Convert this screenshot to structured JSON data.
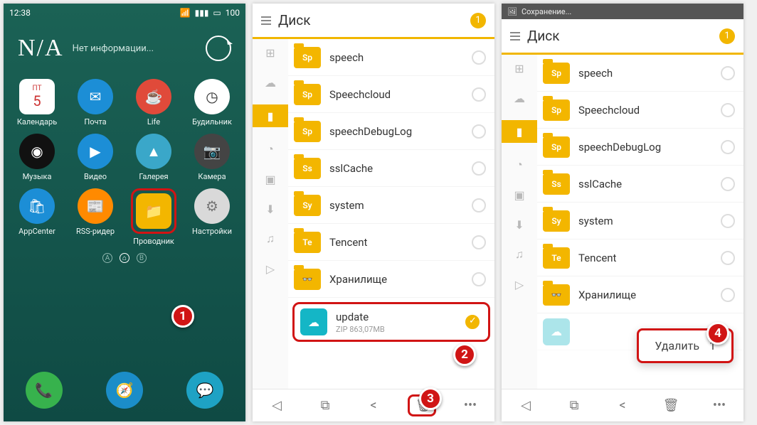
{
  "statusbar": {
    "time": "12:38",
    "battery": "100"
  },
  "weather": {
    "na": "N/A",
    "info": "Нет информации..."
  },
  "apps_row1": [
    {
      "label": "Календарь",
      "short": "5",
      "sup": "ПТ",
      "color": "#ffffff",
      "fg": "#cc3333"
    },
    {
      "label": "Почта",
      "glyph": "✉",
      "color": "#1c8ed6"
    },
    {
      "label": "Life",
      "glyph": "☕",
      "color": "#e04a3a"
    },
    {
      "label": "Будильник",
      "glyph": "◷",
      "color": "#ffffff",
      "fg": "#333333"
    }
  ],
  "apps_row2": [
    {
      "label": "Музыка",
      "glyph": "◉",
      "color": "#111111"
    },
    {
      "label": "Видео",
      "glyph": "▶",
      "color": "#1c8ed6"
    },
    {
      "label": "Галерея",
      "glyph": "▲",
      "color": "#3aa7c9"
    },
    {
      "label": "Камера",
      "glyph": "📷",
      "color": "#444444"
    }
  ],
  "apps_row3": [
    {
      "label": "AppCenter",
      "glyph": "🛍",
      "color": "#1c8ed6"
    },
    {
      "label": "RSS-ридер",
      "glyph": "📰",
      "color": "#ff8a00"
    },
    {
      "label": "Проводник",
      "glyph": "📁",
      "color": "#f3b600",
      "highlight": true
    },
    {
      "label": "Настройки",
      "glyph": "⚙",
      "color": "#d9d9d9",
      "fg": "#777"
    }
  ],
  "dock": [
    {
      "glyph": "📞",
      "color": "#37b24d"
    },
    {
      "glyph": "🧭",
      "color": "#1b8dc8"
    },
    {
      "glyph": "💬",
      "color": "#1ea2c4"
    }
  ],
  "callouts": {
    "c1": "1",
    "c2": "2",
    "c3": "3",
    "c4": "4"
  },
  "fm": {
    "title": "Диск",
    "badge": "1",
    "saving": "Сохранение...",
    "items": [
      {
        "tag": "Sp",
        "name": "speech"
      },
      {
        "tag": "Sp",
        "name": "Speechcloud"
      },
      {
        "tag": "Sp",
        "name": "speechDebugLog"
      },
      {
        "tag": "Ss",
        "name": "sslCache"
      },
      {
        "tag": "Sy",
        "name": "system"
      },
      {
        "tag": "Te",
        "name": "Tencent"
      },
      {
        "tag": "👓",
        "name": "Хранилище",
        "storage": true
      }
    ],
    "update": {
      "name": "update",
      "sub": "ZIP 863,07MB"
    },
    "delete_popup": {
      "label": "Удалить",
      "count": "1"
    }
  }
}
